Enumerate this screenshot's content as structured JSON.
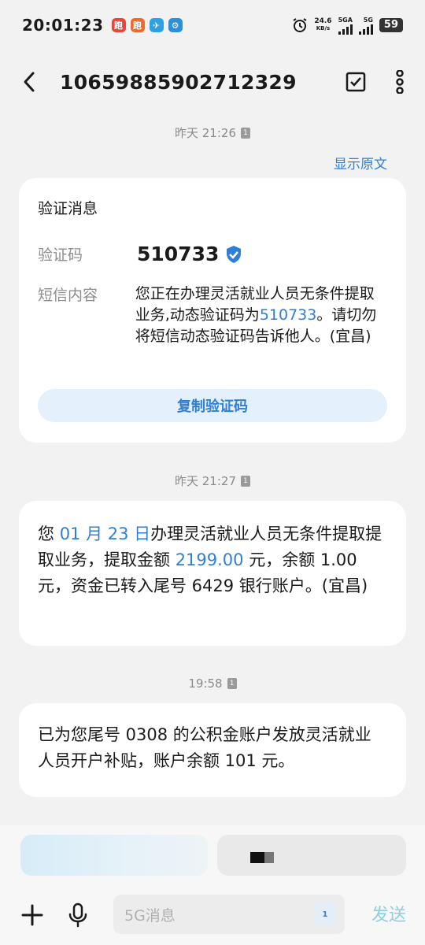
{
  "status_bar": {
    "time": "20:01:23",
    "net_speed_value": "24.6",
    "net_speed_unit": "KB/s",
    "sig1_label": "5GA",
    "sig2_label": "5G",
    "battery": "59"
  },
  "header": {
    "title": "10659885902712329"
  },
  "thread": {
    "ts1": "昨天 21:26",
    "ts1_sim": "1",
    "show_original": "显示原文",
    "card1": {
      "heading": "验证消息",
      "code_label": "验证码",
      "code": "510733",
      "content_label": "短信内容",
      "content_part1": "您正在办理灵活就业人员无条件提取业务,动态验证码为",
      "content_code": "510733",
      "content_part2": "。请切勿将短信动态验证码告诉他人。(宜昌)",
      "copy_button": "复制验证码"
    },
    "ts2": "昨天 21:27",
    "ts2_sim": "1",
    "card2": {
      "p1": "您 ",
      "date": "01 月 23 日",
      "p2": "办理灵活就业人员无条件提取提取业务，提取金额 ",
      "amount": "2199.00",
      "p3": " 元，余额 1.00 元，资金已转入尾号 6429 银行账户。(宜昌)"
    },
    "ts3": "19:58",
    "ts3_sim": "1",
    "card3": {
      "text": "已为您尾号 0308 的公积金账户发放灵活就业人员开户补贴，账户余额 101 元。"
    }
  },
  "composer": {
    "placeholder": "5G消息",
    "sim_badge": "1",
    "send_label": "发送"
  }
}
